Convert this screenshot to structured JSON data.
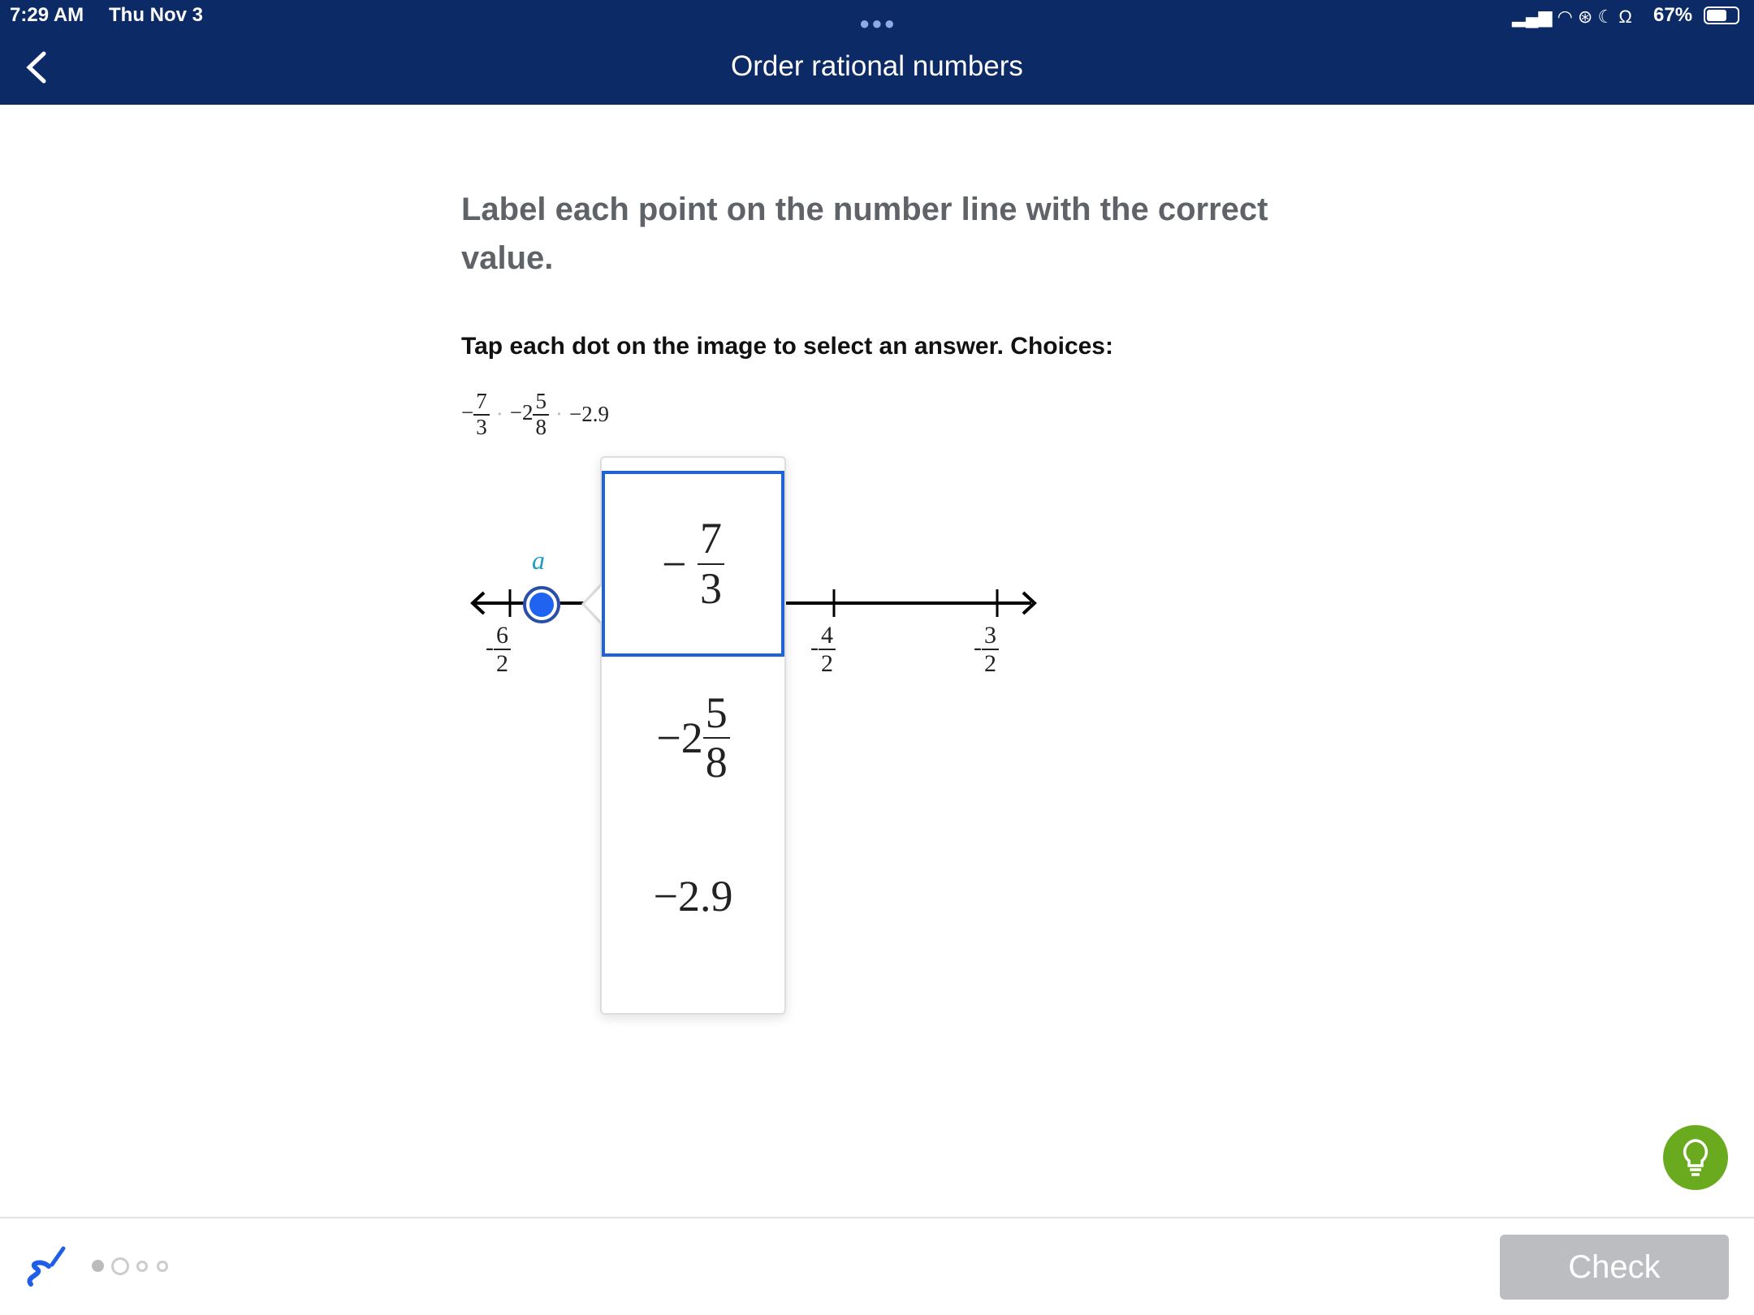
{
  "status_bar": {
    "time": "7:29 AM",
    "date": "Thu Nov 3",
    "battery": "67%",
    "icons": [
      "signal-icon",
      "wifi-icon",
      "orientation-lock-icon",
      "moon-icon",
      "headphones-icon",
      "battery-icon"
    ]
  },
  "header": {
    "title": "Order rational numbers",
    "back_icon": "chevron-left-icon"
  },
  "question": {
    "prompt": "Label each point on the number line with the correct value.",
    "instruction": "Tap each dot on the image to select an answer. Choices:"
  },
  "choices": [
    {
      "sign": "−",
      "whole": "",
      "num": "7",
      "den": "3"
    },
    {
      "sign": "−",
      "whole": "2",
      "num": "5",
      "den": "8"
    },
    {
      "text": "−2.9"
    }
  ],
  "number_line": {
    "point_label": "a",
    "ticks": [
      {
        "sign": "-",
        "num": "6",
        "den": "2"
      },
      {
        "sign": "-",
        "num": "4",
        "den": "2"
      },
      {
        "sign": "-",
        "num": "3",
        "den": "2"
      }
    ]
  },
  "dropdown": {
    "selected_index": 0
  },
  "footer": {
    "check_label": "Check",
    "progress_dots": 4,
    "current_dot": 1
  },
  "colors": {
    "header_bg": "#0b2a66",
    "accent": "#1f63d6",
    "hint": "#6aaa1f",
    "check_disabled": "#bbbdc0"
  }
}
